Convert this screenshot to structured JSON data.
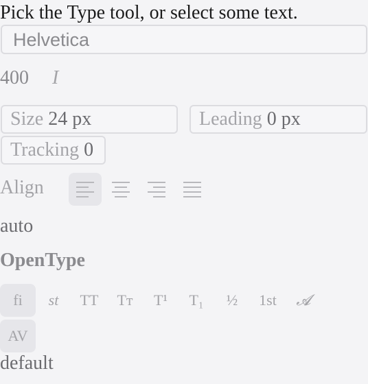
{
  "hint": "Pick the Type tool, or select some text.",
  "font_family_value": "Helvetica",
  "font_weight": "400",
  "italic_icon_glyph": "I",
  "size": {
    "label": "Size",
    "value": "24 px"
  },
  "leading": {
    "label": "Leading",
    "value": "0 px"
  },
  "tracking": {
    "label": "Tracking",
    "value": "0"
  },
  "align": {
    "label": "Align",
    "options": [
      {
        "name": "align-left-icon",
        "active": true
      },
      {
        "name": "align-center-icon",
        "active": false
      },
      {
        "name": "align-right-icon",
        "active": false
      },
      {
        "name": "align-justify-icon",
        "active": false
      }
    ]
  },
  "hyphenation_value": "auto",
  "opentype": {
    "heading": "OpenType",
    "features_row1": [
      "fi",
      "st",
      "TT",
      "Tт",
      "T¹",
      "T₁",
      "½",
      "1st",
      "𝓐"
    ],
    "features_row2": [
      "AV"
    ],
    "value": "default"
  },
  "colors": {
    "background": "#f4f4f6",
    "active_button": "#e6e6ea",
    "muted_text": "#a4a4a8"
  }
}
